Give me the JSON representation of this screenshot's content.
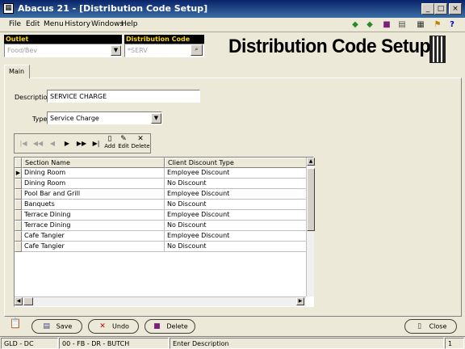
{
  "window": {
    "title": "Abacus 21 - [Distribution Code Setup]",
    "controls": {
      "minimize": "_",
      "restore": "□",
      "close": "×"
    }
  },
  "menu": [
    "File",
    "Edit",
    "Menu",
    "History",
    "Windows",
    "Help"
  ],
  "toolbar_icons": [
    "arrow-left-icon",
    "arrow-right-icon",
    "book-icon",
    "printer-icon",
    "calculator-icon",
    "exit-icon",
    "help-icon"
  ],
  "outlet": {
    "label": "Outlet",
    "value": "Food/Bev"
  },
  "distribution_code": {
    "label": "Distribution Code",
    "value": "*SERV"
  },
  "page_title": "Distribution Code Setup",
  "tabs": [
    {
      "label": "Main"
    }
  ],
  "form": {
    "description_label": "Description",
    "description_value": "SERVICE CHARGE",
    "type_label": "Type",
    "type_value": "Service Charge"
  },
  "nav": {
    "add_label": "Add",
    "edit_label": "Edit",
    "delete_label": "Delete"
  },
  "grid": {
    "columns": [
      "Section Name",
      "Client Discount Type"
    ],
    "rows": [
      {
        "section": "Dining Room",
        "discount": "Employee Discount"
      },
      {
        "section": "Dining Room",
        "discount": "No Discount"
      },
      {
        "section": "Pool Bar and Grill",
        "discount": "Employee Discount"
      },
      {
        "section": "Banquets",
        "discount": "No Discount"
      },
      {
        "section": "Terrace Dining",
        "discount": "Employee Discount"
      },
      {
        "section": "Terrace Dining",
        "discount": "No Discount"
      },
      {
        "section": "Cafe Tangier",
        "discount": "Employee Discount"
      },
      {
        "section": "Cafe Tangier",
        "discount": "No Discount"
      }
    ]
  },
  "buttons": {
    "save": "Save",
    "undo": "Undo",
    "delete": "Delete",
    "close": "Close"
  },
  "status": {
    "panel1": "GLD - DC",
    "panel2": "00 - FB - DR - BUTCH",
    "panel3": "Enter Description",
    "panel4": "1"
  }
}
